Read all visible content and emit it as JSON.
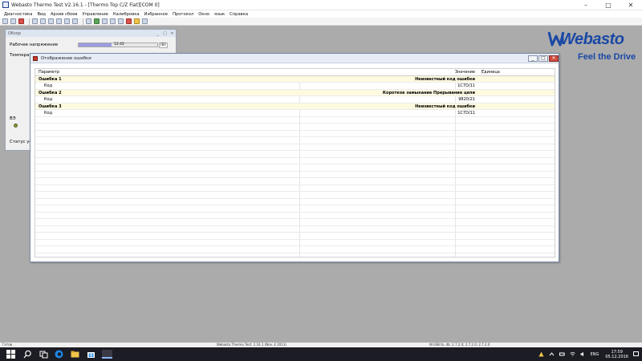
{
  "window": {
    "title": "Webasto Thermo Test V2.16.1 - [Thermo Top C/Z Fiat][COM 0]",
    "minimize": "–",
    "maximize": "□",
    "close": "✕"
  },
  "menu": [
    "Диагностика",
    "Вид",
    "Архив сбоев",
    "Управление",
    "Калибровка",
    "Избранное",
    "Протокол",
    "Окно",
    "язык",
    "Справка"
  ],
  "logo": {
    "brand": "Webasto",
    "tagline": "Feel the Drive",
    "color": "#1a48a5"
  },
  "overview": {
    "title": "Обзор",
    "voltage_label": "Рабочее напряжение",
    "voltage_value": "12.42",
    "voltage_unit": "[B]",
    "voltage_fraction": 0.42,
    "temp_label": "Температ",
    "led_label": "ВЭ",
    "status_label": "Статус устр"
  },
  "error_window": {
    "title": "Отображение ошибки",
    "columns": {
      "param": "Параметр",
      "value": "Значение",
      "unit": "Единица"
    },
    "rows": [
      {
        "param": "Ошибка 1",
        "value": "Неизвестный код ошибки",
        "type": "error"
      },
      {
        "param": "Код",
        "value": "1C7D/11",
        "type": "code"
      },
      {
        "param": "Ошибка 2",
        "value": "Короткое замыкание Прерывание цепи",
        "type": "error"
      },
      {
        "param": "Код",
        "value": "9820/21",
        "type": "code"
      },
      {
        "param": "Ошибка 3",
        "value": "Неизвестный код ошибки",
        "type": "error"
      },
      {
        "param": "Код",
        "value": "1C7D/11",
        "type": "code"
      }
    ]
  },
  "statusbar": {
    "left": "Готов",
    "center": "Webasto Thermo Test: 2.16.1 (Nov. 4 2013)",
    "right": "W.USB lb, db: 2.7.2.0; 2.7.2.0; 2.7.2.0"
  },
  "taskbar": {
    "lang": "ENG",
    "time": "17:59",
    "date": "05.12.2016"
  }
}
